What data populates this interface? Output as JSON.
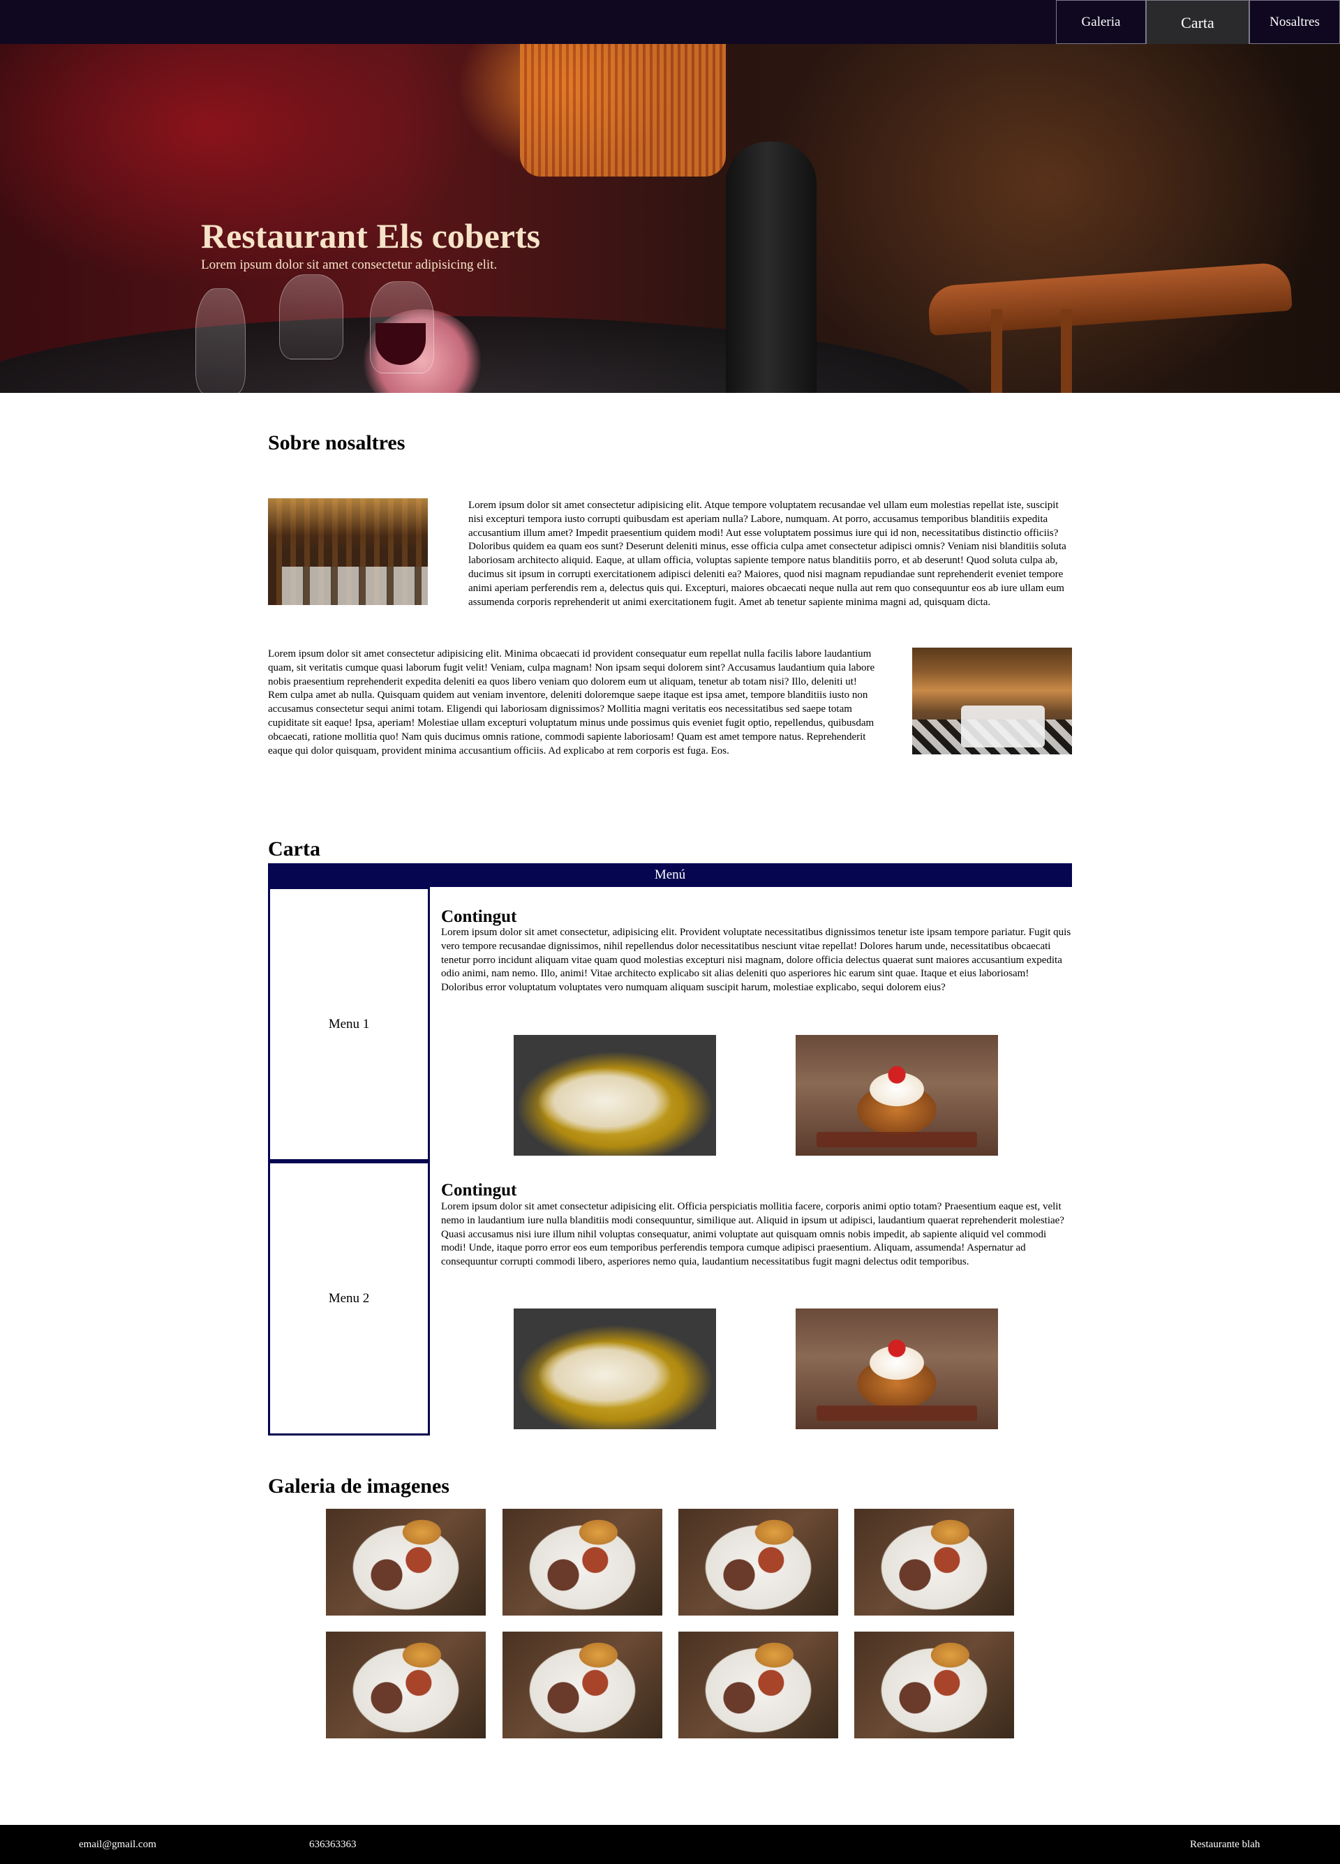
{
  "nav": {
    "items": [
      {
        "label": "Galeria"
      },
      {
        "label": "Carta"
      },
      {
        "label": "Nosaltres"
      }
    ]
  },
  "hero": {
    "title": "Restaurant Els coberts",
    "subtitle": "Lorem ipsum dolor sit amet consectetur adipisicing elit."
  },
  "about": {
    "heading": "Sobre nosaltres",
    "paragraph1": "Lorem ipsum dolor sit amet consectetur adipisicing elit. Atque tempore voluptatem recusandae vel ullam eum molestias repellat iste, suscipit nisi excepturi tempora iusto corrupti quibusdam est aperiam nulla? Labore, numquam. At porro, accusamus temporibus blanditiis expedita accusantium illum amet? Impedit praesentium quidem modi! Aut esse voluptatem possimus iure qui id non, necessitatibus distinctio officiis? Doloribus quidem ea quam eos sunt? Deserunt deleniti minus, esse officia culpa amet consectetur adipisci omnis? Veniam nisi blanditiis soluta laboriosam architecto aliquid. Eaque, at ullam officia, voluptas sapiente tempore natus blanditiis porro, et ab deserunt! Quod soluta culpa ab, ducimus sit ipsum in corrupti exercitationem adipisci deleniti ea? Maiores, quod nisi magnam repudiandae sunt reprehenderit eveniet tempore animi aperiam perferendis rem a, delectus quis qui. Excepturi, maiores obcaecati neque nulla aut rem quo consequuntur eos ab iure ullam eum assumenda corporis reprehenderit ut animi exercitationem fugit. Amet ab tenetur sapiente minima magni ad, quisquam dicta.",
    "paragraph2": "Lorem ipsum dolor sit amet consectetur adipisicing elit. Minima obcaecati id provident consequatur eum repellat nulla facilis labore laudantium quam, sit veritatis cumque quasi laborum fugit velit! Veniam, culpa magnam! Non ipsam sequi dolorem sint? Accusamus laudantium quia labore nobis praesentium reprehenderit expedita deleniti ea quos libero veniam quo dolorem eum ut aliquam, tenetur ab totam nisi? Illo, deleniti ut! Rem culpa amet ab nulla. Quisquam quidem aut veniam inventore, deleniti doloremque saepe itaque est ipsa amet, tempore blanditiis iusto non accusamus consectetur sequi animi totam. Eligendi qui laboriosam dignissimos? Mollitia magni veritatis eos necessitatibus sed saepe totam cupiditate sit eaque! Ipsa, aperiam! Molestiae ullam excepturi voluptatum minus unde possimus quis eveniet fugit optio, repellendus, quibusdam obcaecati, ratione mollitia quo! Nam quis ducimus omnis ratione, commodi sapiente laboriosam! Quam est amet tempore natus. Reprehenderit eaque qui dolor quisquam, provident minima accusantium officiis. Ad explicabo at rem corporis est fuga. Eos."
  },
  "carta": {
    "heading": "Carta",
    "header": "Menú",
    "menus": [
      {
        "label": "Menu 1",
        "title": "Contingut",
        "text": "Lorem ipsum dolor sit amet consectetur, adipisicing elit. Provident voluptate necessitatibus dignissimos tenetur iste ipsam tempore pariatur. Fugit quis vero tempore recusandae dignissimos, nihil repellendus dolor necessitatibus nesciunt vitae repellat! Dolores harum unde, necessitatibus obcaecati tenetur porro incidunt aliquam vitae quam quod molestias excepturi nisi magnam, dolore officia delectus quaerat sunt maiores accusantium expedita odio animi, nam nemo. Illo, animi! Vitae architecto explicabo sit alias deleniti quo asperiores hic earum sint quae. Itaque et eius laboriosam! Doloribus error voluptatum voluptates vero numquam aliquam suscipit harum, molestiae explicabo, sequi dolorem eius?"
      },
      {
        "label": "Menu 2",
        "title": "Contingut",
        "text": "Lorem ipsum dolor sit amet consectetur adipisicing elit. Officia perspiciatis mollitia facere, corporis animi optio totam? Praesentium eaque est, velit nemo in laudantium iure nulla blanditiis modi consequuntur, similique aut. Aliquid in ipsum ut adipisci, laudantium quaerat reprehenderit molestiae? Quasi accusamus nisi iure illum nihil voluptas consequatur, animi voluptate aut quisquam omnis nobis impedit, ab sapiente aliquid vel commodi modi! Unde, itaque porro error eos eum temporibus perferendis tempora cumque adipisci praesentium. Aliquam, assumenda! Aspernatur ad consequuntur corrupti commodi libero, asperiores nemo quia, laudantium necessitatibus fugit magni delectus odit temporibus."
      }
    ]
  },
  "gallery": {
    "heading": "Galeria de imagenes"
  },
  "footer": {
    "email": "email@gmail.com",
    "phone": "636363363",
    "brand": "Restaurante blah"
  }
}
